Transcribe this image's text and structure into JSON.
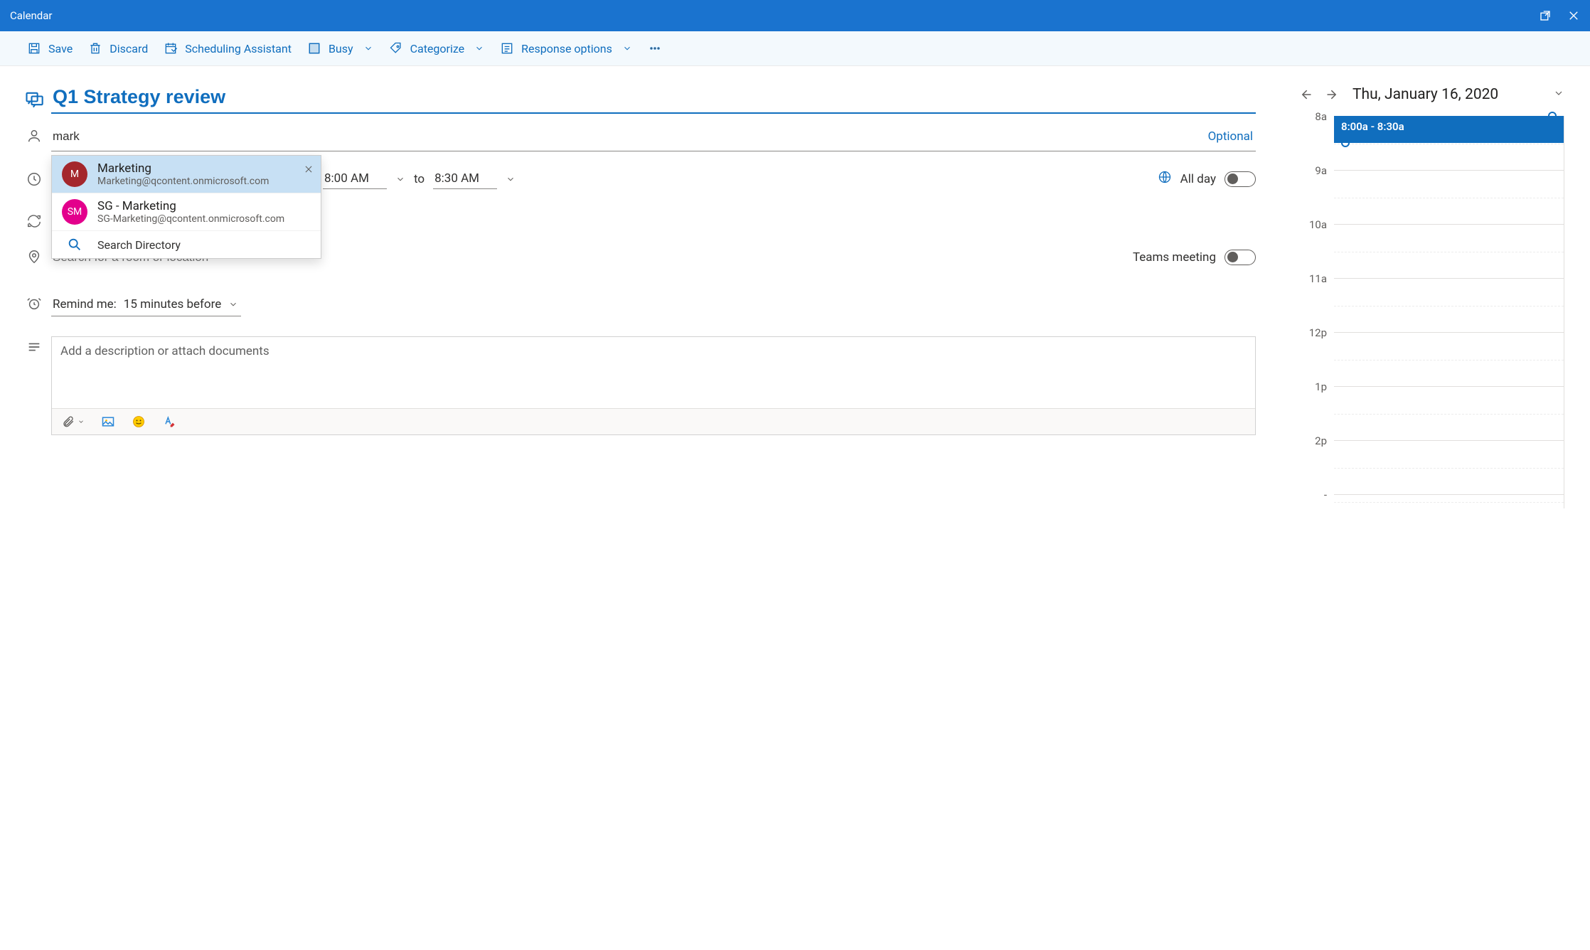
{
  "window": {
    "title": "Calendar"
  },
  "commands": {
    "save": "Save",
    "discard": "Discard",
    "scheduling": "Scheduling Assistant",
    "busy": "Busy",
    "categorize": "Categorize",
    "response": "Response options"
  },
  "event": {
    "title": "Q1 Strategy review",
    "invitee_query": "mark",
    "optional_label": "Optional",
    "start_time": "8:00 AM",
    "to_label": "to",
    "end_time": "8:30 AM",
    "all_day_label": "All day",
    "location_placeholder": "Search for a room or location",
    "teams_label": "Teams meeting",
    "reminder_label": "Remind me:",
    "reminder_value": "15 minutes before",
    "description_placeholder": "Add a description or attach documents"
  },
  "suggestions": {
    "items": [
      {
        "initials": "M",
        "color": "#a4262c",
        "name": "Marketing",
        "email": "Marketing@qcontent.onmicrosoft.com",
        "removable": true
      },
      {
        "initials": "SM",
        "color": "#e3008c",
        "name": "SG - Marketing",
        "email": "SG-Marketing@qcontent.onmicrosoft.com",
        "removable": false
      }
    ],
    "search_directory": "Search Directory"
  },
  "timeline": {
    "date_label": "Thu, January 16, 2020",
    "hours": [
      "8a",
      "9a",
      "10a",
      "11a",
      "12p",
      "1p",
      "2p"
    ],
    "event_label": "8:00a - 8:30a",
    "event_start_index": 0,
    "event_duration_halves": 1
  }
}
